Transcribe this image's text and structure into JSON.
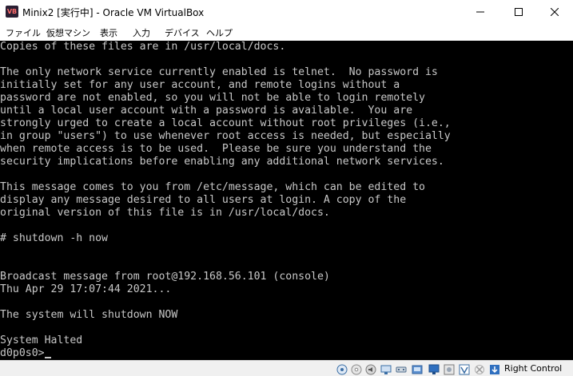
{
  "window": {
    "title": "Minix2 [実行中] - Oracle VM VirtualBox",
    "app_icon_label": "VB"
  },
  "menu": {
    "items": [
      "ファイル",
      "仮想マシン",
      "表示",
      "入力",
      "デバイス",
      "ヘルプ"
    ]
  },
  "console": {
    "lines": [
      "Copies of these files are in /usr/local/docs.",
      "",
      "The only network service currently enabled is telnet.  No password is",
      "initially set for any user account, and remote logins without a",
      "password are not enabled, so you will not be able to login remotely",
      "until a local user account with a password is available.  You are",
      "strongly urged to create a local account without root privileges (i.e.,",
      "in group \"users\") to use whenever root access is needed, but especially",
      "when remote access is to be used.  Please be sure you understand the",
      "security implications before enabling any additional network services.",
      "",
      "This message comes to you from /etc/message, which can be edited to",
      "display any message desired to all users at login. A copy of the",
      "original version of this file is in /usr/local/docs.",
      "",
      "# shutdown -h now",
      "",
      "",
      "Broadcast message from root@192.168.56.101 (console)",
      "Thu Apr 29 17:07:44 2021...",
      "",
      "The system will shutdown NOW",
      "",
      "System Halted",
      "d0p0s0>"
    ]
  },
  "statusbar": {
    "icons": [
      "hard-disk-icon",
      "optical-drive-icon",
      "audio-icon",
      "network-icon",
      "usb-icon",
      "shared-folders-icon",
      "display-icon",
      "video-capture-icon",
      "virtualization-icon",
      "mouse-integration-icon",
      "host-key-arrow-icon"
    ],
    "host_key": "Right Control"
  }
}
